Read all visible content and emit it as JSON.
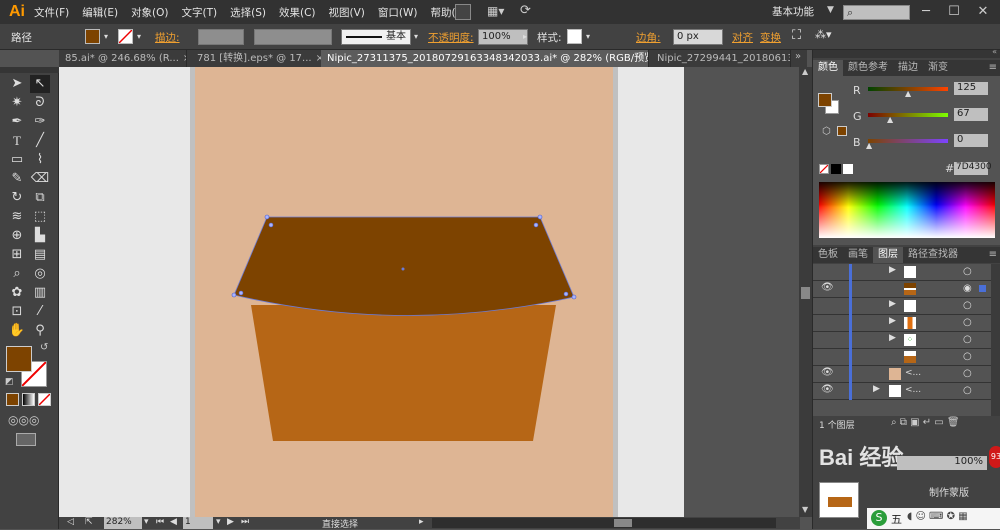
{
  "app": {
    "logo": "Ai",
    "workspace": "基本功能"
  },
  "menu": [
    "文件(F)",
    "编辑(E)",
    "对象(O)",
    "文字(T)",
    "选择(S)",
    "效果(C)",
    "视图(V)",
    "窗口(W)",
    "帮助(H)"
  ],
  "control": {
    "object_type": "路径",
    "stroke_label": "描边:",
    "stroke_profile": "基本",
    "opacity_label": "不透明度:",
    "opacity_value": "100%",
    "style_label": "样式:",
    "corner_label": "边角:",
    "corner_value": "0 px",
    "align_label": "对齐",
    "transform_label": "变换",
    "fill_color": "#7D4300"
  },
  "tabs": [
    {
      "label": "85.ai* @ 246.68% (R...",
      "active": false
    },
    {
      "label": "781 [转换].eps* @ 17...",
      "active": false
    },
    {
      "label": "Nipic_27311375_20180729163348342033.ai* @ 282% (RGB/预览)",
      "active": true
    },
    {
      "label": "Nipic_27299441_20180613",
      "active": false
    }
  ],
  "color_panel": {
    "tabs": [
      "颜色",
      "颜色参考",
      "描边",
      "渐变"
    ],
    "r_label": "R",
    "r_value": "125",
    "g_label": "G",
    "g_value": "67",
    "b_label": "B",
    "b_value": "0",
    "hex_label": "#",
    "hex_value": "7D4300"
  },
  "layers_panel": {
    "tabs": [
      "色板",
      "画笔",
      "图层",
      "路径查找器"
    ],
    "footer": "1 个图层"
  },
  "status": {
    "zoom": "282%",
    "page": "1",
    "tool": "直接选择"
  },
  "watermark": {
    "text": "Bai 经验",
    "badge": "93",
    "button": "制作蒙版"
  },
  "ime": {
    "label": "五"
  },
  "colors": {
    "artboard": "#DEB594",
    "top_shape": "#7D4300",
    "bottom_shape": "#B66616",
    "accent": "#F0A030"
  }
}
